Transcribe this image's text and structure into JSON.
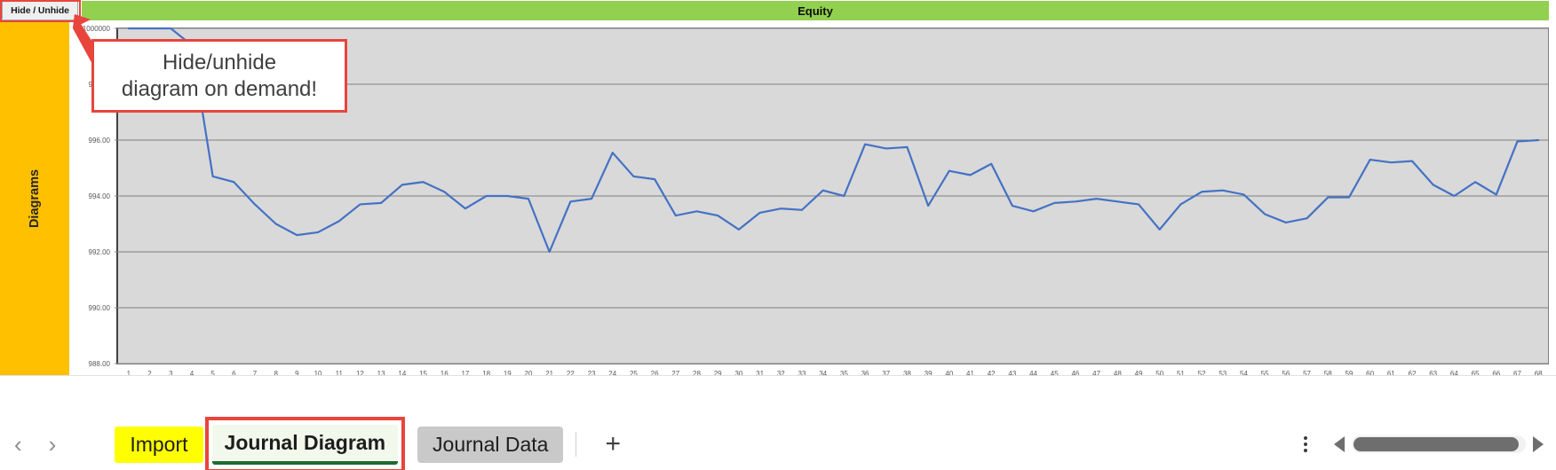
{
  "window": {
    "hide_unhide_button": "Hide / Unhide",
    "chart_title": "Equity",
    "sidebar_label": "Diagrams"
  },
  "callout": {
    "line1": "Hide/unhide",
    "line2": "diagram on demand!"
  },
  "colors": {
    "title_bar_green": "#92d050",
    "sidebar_orange": "#ffc000",
    "callout_red": "#e8453c",
    "line_blue": "#4472c4",
    "plot_background": "#d9d9d9",
    "import_tab_yellow": "#ffff00",
    "active_tab_underline": "#1e6b2e"
  },
  "tabbar": {
    "prev_label": "‹",
    "next_label": "›",
    "add_label": "+",
    "tabs": [
      {
        "label": "Import",
        "state": "highlighted"
      },
      {
        "label": "Journal Diagram",
        "state": "active"
      },
      {
        "label": "Journal Data",
        "state": "inactive"
      }
    ]
  },
  "chart_data": {
    "type": "line",
    "title": "Equity",
    "xlabel": "",
    "ylabel": "",
    "grid": true,
    "legend": false,
    "ylim": [
      988000,
      1000000
    ],
    "yticks": [
      1000000,
      998000,
      996000,
      994000,
      992000,
      990000,
      988000
    ],
    "ytick_labels": [
      "1000000",
      "998.00",
      "996.00",
      "994.00",
      "992.00",
      "990.00",
      "988.00"
    ],
    "x": [
      1,
      2,
      3,
      4,
      5,
      6,
      7,
      8,
      9,
      10,
      11,
      12,
      13,
      14,
      15,
      16,
      17,
      18,
      19,
      20,
      21,
      22,
      23,
      24,
      25,
      26,
      27,
      28,
      29,
      30,
      31,
      32,
      33,
      34,
      35,
      36,
      37,
      38,
      39,
      40,
      41,
      42,
      43,
      44,
      45,
      46,
      47,
      48,
      49,
      50,
      51,
      52,
      53,
      54,
      55,
      56,
      57,
      58,
      59,
      60,
      61,
      62,
      63,
      64,
      65,
      66,
      67,
      68
    ],
    "xtick_labels": [
      "1",
      "2",
      "3",
      "4",
      "5",
      "6",
      "7",
      "8",
      "9",
      "10",
      "11",
      "12",
      "13",
      "14",
      "15",
      "16",
      "17",
      "18",
      "19",
      "20",
      "21",
      "22",
      "23",
      "24",
      "25",
      "26",
      "27",
      "28",
      "29",
      "30",
      "31",
      "32",
      "33",
      "34",
      "35",
      "36",
      "37",
      "38",
      "39",
      "40",
      "41",
      "42",
      "43",
      "44",
      "45",
      "46",
      "47",
      "48",
      "49",
      "50",
      "51",
      "52",
      "53",
      "54",
      "55",
      "56",
      "57",
      "58",
      "59",
      "60",
      "61",
      "62",
      "63",
      "64",
      "65",
      "66",
      "67",
      "68"
    ],
    "series": [
      {
        "name": "Equity",
        "color": "#4472c4",
        "values": [
          1000000,
          1000000,
          1000000,
          999400,
          994700,
          994500,
          993700,
          993000,
          992600,
          992700,
          993100,
          993700,
          993750,
          994400,
          994500,
          994150,
          993550,
          994000,
          994000,
          993900,
          992000,
          993800,
          993900,
          995550,
          994700,
          994600,
          993300,
          993450,
          993300,
          992800,
          993400,
          993550,
          993500,
          994200,
          994000,
          995850,
          995700,
          995750,
          993650,
          994900,
          994750,
          995150,
          993650,
          993450,
          993750,
          993800,
          993900,
          993800,
          993700,
          992800,
          993700,
          994150,
          994200,
          994050,
          993350,
          993050,
          993200,
          993950,
          993950,
          995300,
          995200,
          995250,
          994400,
          994000,
          994500,
          994050,
          995950,
          996000
        ]
      }
    ]
  }
}
